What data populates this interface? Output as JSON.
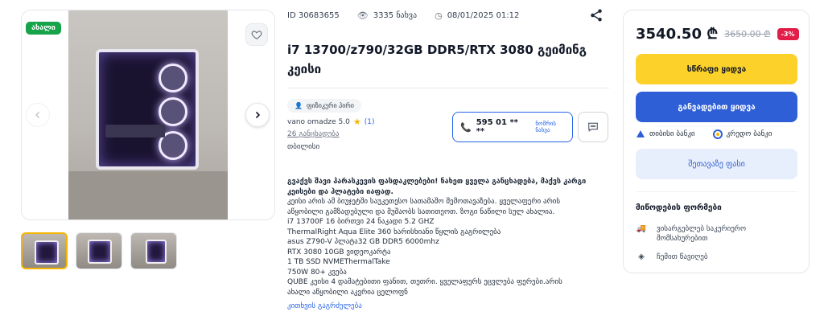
{
  "gallery": {
    "badge": "ახალი",
    "thumbnails": [
      "thumb-1",
      "thumb-2",
      "thumb-3"
    ]
  },
  "meta": {
    "id": "ID 30683655",
    "views": "3335 ნახვა",
    "date": "08/01/2025 01:12"
  },
  "title": "i7 13700/z790/32GB DDR5/RTX 3080 გეიმინგ კეისი",
  "seller": {
    "tag": "ფიზიკური პირი",
    "name": "vano omadze 5.0",
    "reviews": "(1)",
    "all_ads": "26 განცხადება",
    "city": "თბილისი"
  },
  "contact": {
    "phone": "595 01 ** **",
    "show_number": "ნომრის ნახვა"
  },
  "description": {
    "headline": "გვაქვს შავი პარასკევის ფასდაკლებები! ნახეთ ყველა განცხადება, მაქვს კარგი კეისები და ჰლატები იაფად.",
    "lines": [
      "კეისი არის ამ ბიუჯეტში საუკეთესო სათამაშო შემოთავაზება. ყველაფერი არის",
      "აწყობილი გამზადებული და მუშაობს სათითეოთ. ზოგი ნაწილი სულ ახალია.",
      "i7 13700F 16 ბირთვი 24 ნაკადი 5.2 GHZ",
      "ThermalRight Aqua Elite 360 ხარისხიანი წყლის გაგრილება",
      "asus Z790-V პლატა32 GB DDR5 6000mhz",
      "RTX 3080 10GB ვიდეოკარტა",
      "1 TB SSD NVMEThermalTake",
      "750W 80+ კვება",
      "QUBE კეისი 4 დამატებითი ფანით, თეთრი. ყველაფერს ეცვლება ფერები.არის",
      "ახალი აწყობილი აკვრია ცელოფნ"
    ],
    "read_more": "კითხვის გაგრძელება"
  },
  "purchase": {
    "price": "3540.50 ₾",
    "old_price": "3650.00 ₾",
    "discount": "-3%",
    "buy_now": "სწრაფი ყიდვა",
    "installment": "განვადებით ყიდვა",
    "bank1": "თიბისი ბანკი",
    "bank2": "კრედო ბანკი",
    "offer_price": "შეთავაზე ფასი",
    "delivery_title": "მიწოდების ფორმები",
    "delivery1": "ვისარგებლებ საკურიერო მომსახურებით",
    "delivery2": "ჩემით წავიღებ"
  },
  "colors": {
    "primary_blue": "#2f5fd7",
    "buy_yellow": "#fcd12a",
    "new_badge_green": "#16a34a",
    "discount_red": "#e11d48"
  }
}
